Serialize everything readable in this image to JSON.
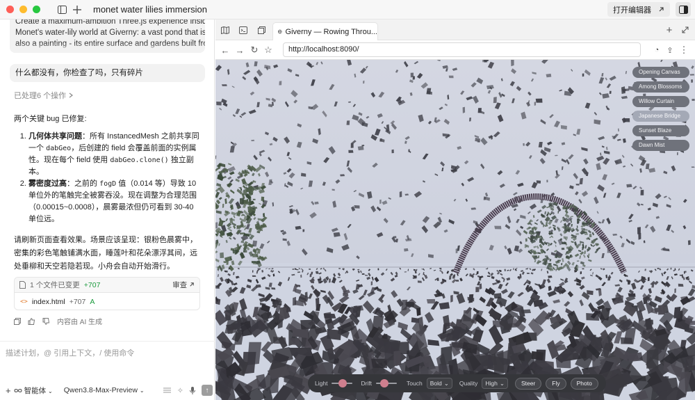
{
  "app": {
    "session_title": "monet water lilies immersion",
    "open_editor_label": "打开编辑器"
  },
  "chat": {
    "prompt_lines": [
      "Create a maximum-ambition Three.js experience inside",
      "Monet's water-lily world at Giverny: a vast pond that is",
      "also a painting - its entire surface and gardens built from"
    ],
    "user_message": "什么都没有，你检查了吗，只有碎片",
    "processed": {
      "prefix": "已处理 ",
      "count": "6 个操作"
    },
    "answer": {
      "intro": "两个关键 bug 已修复:",
      "item1": {
        "title": "几何体共享问题",
        "t1": "：所有 InstancedMesh 之前共享同一个 ",
        "c1": "dabGeo",
        "t2": "，后创建的 field 会覆盖前面的实例属性。现在每个 field 使用 ",
        "c2": "dabGeo.clone()",
        "t3": " 独立副本。"
      },
      "item2": {
        "title": "雾密度过高",
        "t1": "：之前的 ",
        "c1": "fogD",
        "t2": " 值（0.014 等）导致 10 单位外的笔触完全被雾吞没。现在调整为合理范围（0.00015~0.0008），晨雾最浓但仍可看到 30-40 单位远。"
      },
      "outro": "请刷新页面查看效果。场景应该呈现：银粉色晨雾中，密集的彩色笔触铺满水面，睡莲叶和花朵漂浮其间，远处垂柳和天空若隐若现。小舟会自动开始滑行。"
    },
    "file_card": {
      "header": "1 个文件已变更",
      "header_added": "+707",
      "review": "审查",
      "file_name": "index.html",
      "file_added": "+707",
      "file_status": "A"
    },
    "feedback_text": "内容由 AI 生成",
    "composer": {
      "placeholder": "描述计划，@ 引用上下文，/ 使用命令",
      "agent_label": "智能体",
      "model": "Qwen3.8-Max-Preview"
    }
  },
  "browser": {
    "tab_title": "Giverny — Rowing Throu...",
    "url": "http://localhost:8090/",
    "scene_buttons": [
      {
        "label": "Opening Canvas",
        "active": false
      },
      {
        "label": "Among Blossoms",
        "active": false
      },
      {
        "label": "Willow Curtain",
        "active": false
      },
      {
        "label": "Japanese Bridge",
        "active": true
      },
      {
        "label": "Sunset Blaze",
        "active": false
      },
      {
        "label": "Dawn Mist",
        "active": false
      }
    ],
    "controls": {
      "light_label": "Light",
      "drift_label": "Drift",
      "touch_label": "Touch",
      "touch_value": "Bold",
      "quality_label": "Quality",
      "quality_value": "High",
      "steer_label": "Steer",
      "fly_label": "Fly",
      "photo_label": "Photo"
    },
    "colors": {
      "sky": "#cdd3e0",
      "dab": "#3c3a42",
      "bridge": "#4a3d4e",
      "slider_knob": "#cf7f8e"
    }
  }
}
